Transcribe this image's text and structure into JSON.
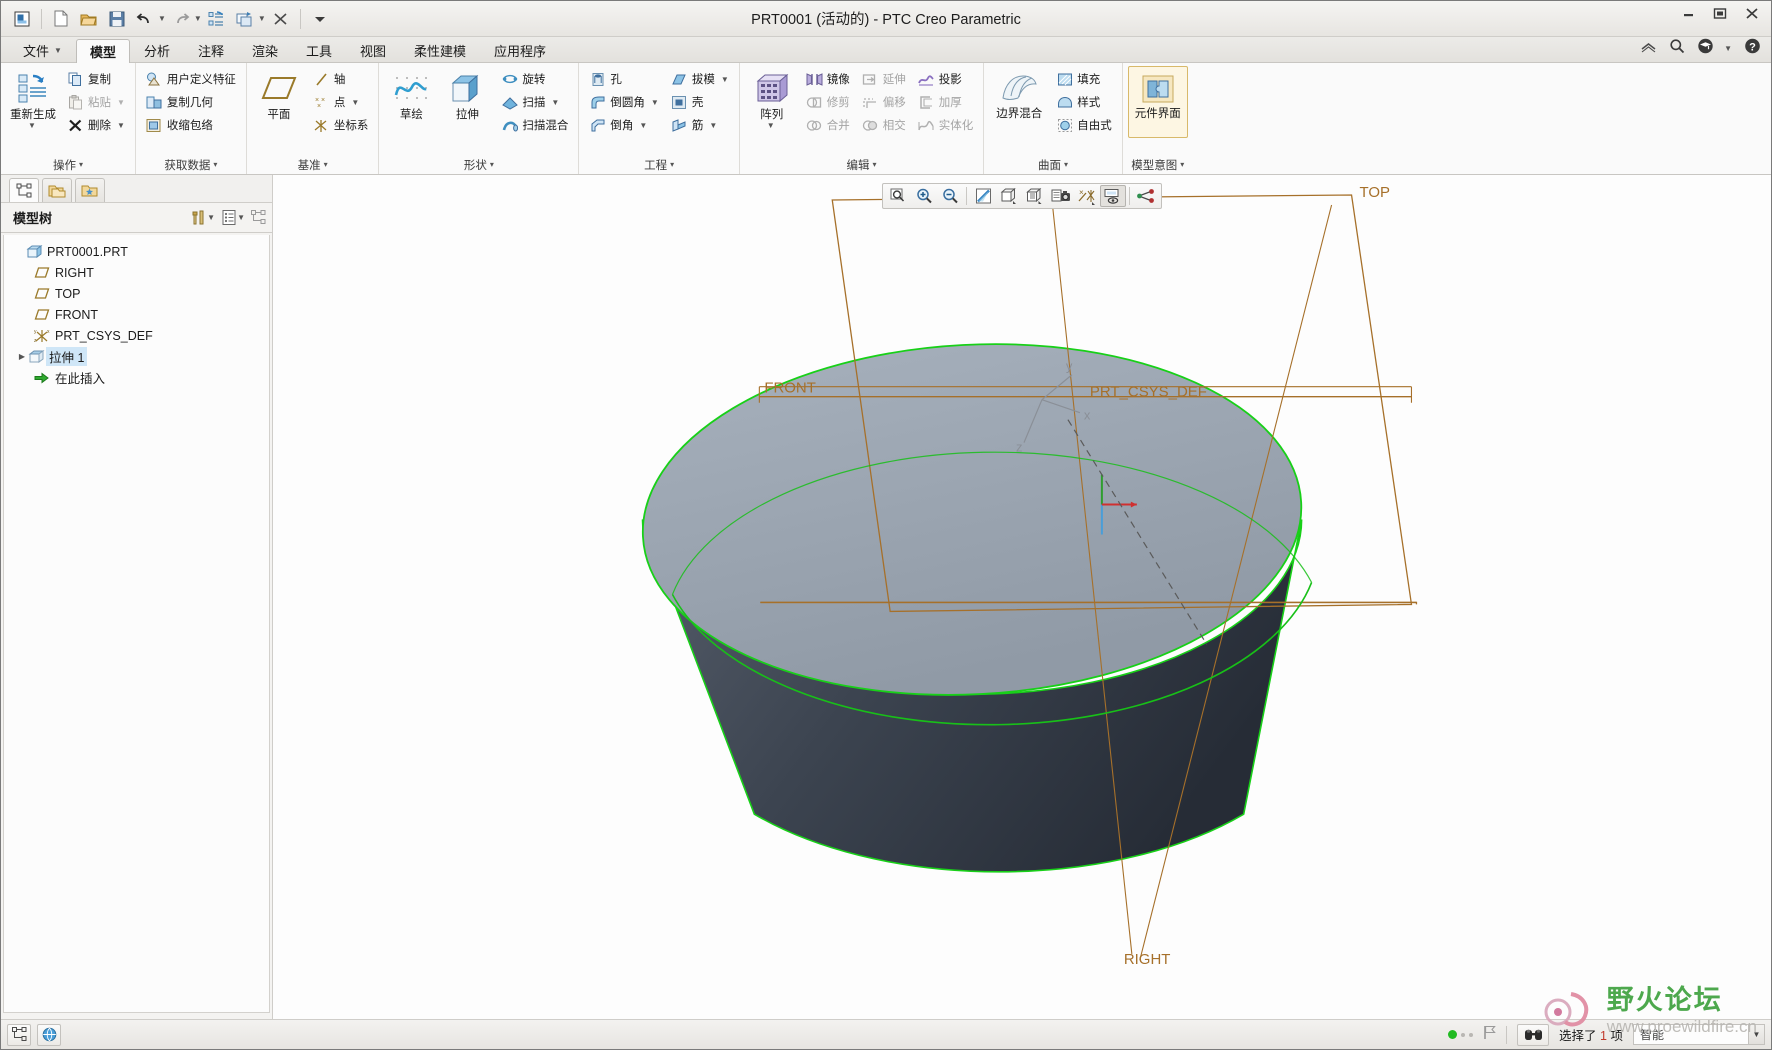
{
  "window": {
    "title": "PRT0001 (活动的) - PTC Creo Parametric",
    "minimize": "—",
    "maximize": "❐",
    "close": "✕"
  },
  "quick_access": [
    {
      "name": "app-icon",
      "icon": "window-icon"
    },
    {
      "name": "new-file",
      "icon": "page-icon"
    },
    {
      "name": "open-file",
      "icon": "folder-open-icon"
    },
    {
      "name": "save-file",
      "icon": "floppy-icon"
    },
    {
      "name": "undo",
      "icon": "undo-arrow-icon"
    },
    {
      "name": "redo",
      "icon": "redo-arrow-icon"
    },
    {
      "name": "regenerate",
      "icon": "regenerate-icon"
    },
    {
      "name": "window-switch",
      "icon": "windows-icon"
    },
    {
      "name": "close-window",
      "icon": "close-x-icon"
    },
    {
      "name": "customize-qat",
      "icon": "chevron-down-icon"
    }
  ],
  "tabs": [
    {
      "label": "文件",
      "dropdown": true,
      "active": false
    },
    {
      "label": "模型",
      "active": true
    },
    {
      "label": "分析",
      "active": false
    },
    {
      "label": "注释",
      "active": false
    },
    {
      "label": "渲染",
      "active": false
    },
    {
      "label": "工具",
      "active": false
    },
    {
      "label": "视图",
      "active": false
    },
    {
      "label": "柔性建模",
      "active": false
    },
    {
      "label": "应用程序",
      "active": false
    }
  ],
  "tab_right_tools": [
    {
      "name": "collapse-ribbon-icon",
      "glyph": "⌃"
    },
    {
      "name": "search-icon",
      "glyph": "search"
    },
    {
      "name": "help-center-icon",
      "glyph": "graduation"
    },
    {
      "name": "help-dropdown-icon",
      "glyph": "▾"
    },
    {
      "name": "help-icon",
      "glyph": "?"
    }
  ],
  "ribbon": {
    "groups": [
      {
        "title": "操作",
        "big": [
          {
            "label": "重新生成",
            "icon": "regenerate-icon",
            "dropdown": true
          }
        ],
        "columns": [
          [
            {
              "label": "复制",
              "icon": "copy-icon",
              "disabled": false
            },
            {
              "label": "粘贴",
              "icon": "paste-icon",
              "disabled": true,
              "dropdown": true
            },
            {
              "label": "删除",
              "icon": "delete-x-icon",
              "disabled": false,
              "dropdown": true
            }
          ]
        ]
      },
      {
        "title": "获取数据",
        "big": [],
        "columns": [
          [
            {
              "label": "用户定义特征",
              "icon": "udf-icon"
            },
            {
              "label": "复制几何",
              "icon": "copy-geometry-icon"
            },
            {
              "label": "收缩包络",
              "icon": "shrinkwrap-icon"
            }
          ]
        ]
      },
      {
        "title": "基准",
        "big": [
          {
            "label": "平面",
            "icon": "datum-plane-icon"
          }
        ],
        "columns": [
          [
            {
              "label": "轴",
              "icon": "datum-axis-icon"
            },
            {
              "label": "点",
              "icon": "datum-point-icon",
              "dropdown": true
            },
            {
              "label": "坐标系",
              "icon": "csys-icon"
            }
          ]
        ]
      },
      {
        "title": "形状",
        "big": [
          {
            "label": "草绘",
            "icon": "sketch-icon"
          },
          {
            "label": "拉伸",
            "icon": "extrude-icon"
          }
        ],
        "columns": [
          [
            {
              "label": "旋转",
              "icon": "revolve-icon"
            },
            {
              "label": "扫描",
              "icon": "sweep-icon",
              "dropdown": true
            },
            {
              "label": "扫描混合",
              "icon": "swept-blend-icon"
            }
          ]
        ]
      },
      {
        "title": "工程",
        "big": [],
        "columns": [
          [
            {
              "label": "孔",
              "icon": "hole-icon"
            },
            {
              "label": "倒圆角",
              "icon": "round-icon",
              "dropdown": true
            },
            {
              "label": "倒角",
              "icon": "chamfer-icon",
              "dropdown": true
            }
          ],
          [
            {
              "label": "拔模",
              "icon": "draft-icon",
              "dropdown": true
            },
            {
              "label": "壳",
              "icon": "shell-icon"
            },
            {
              "label": "筋",
              "icon": "rib-icon",
              "dropdown": true
            }
          ]
        ]
      },
      {
        "title": "编辑",
        "big": [
          {
            "label": "阵列",
            "icon": "pattern-icon",
            "dropdown": true
          }
        ],
        "columns": [
          [
            {
              "label": "镜像",
              "icon": "mirror-icon"
            },
            {
              "label": "修剪",
              "icon": "trim-icon",
              "disabled": true
            },
            {
              "label": "合并",
              "icon": "merge-icon",
              "disabled": true
            }
          ],
          [
            {
              "label": "延伸",
              "icon": "extend-icon",
              "disabled": true
            },
            {
              "label": "偏移",
              "icon": "offset-icon",
              "disabled": true
            },
            {
              "label": "相交",
              "icon": "intersect-icon",
              "disabled": true
            }
          ],
          [
            {
              "label": "投影",
              "icon": "project-icon"
            },
            {
              "label": "加厚",
              "icon": "thicken-icon",
              "disabled": true
            },
            {
              "label": "实体化",
              "icon": "solidify-icon",
              "disabled": true
            }
          ]
        ]
      },
      {
        "title": "曲面",
        "big": [
          {
            "label": "边界混合",
            "icon": "boundary-blend-icon"
          }
        ],
        "columns": [
          [
            {
              "label": "填充",
              "icon": "fill-icon"
            },
            {
              "label": "样式",
              "icon": "style-icon"
            },
            {
              "label": "自由式",
              "icon": "freestyle-icon"
            }
          ]
        ]
      },
      {
        "title": "模型意图",
        "big": [
          {
            "label": "元件界面",
            "icon": "component-interface-icon"
          }
        ],
        "columns": []
      }
    ]
  },
  "left_pane": {
    "nav_tabs": [
      {
        "name": "model-tree-tab",
        "icon": "tree-icon",
        "active": true
      },
      {
        "name": "folder-browser-tab",
        "icon": "folders-icon",
        "active": false
      },
      {
        "name": "favorites-tab",
        "icon": "favorites-folder-icon",
        "active": false
      }
    ],
    "tree_header": {
      "title": "模型树",
      "tools": [
        {
          "name": "tree-filter-icon",
          "glyph": "tools",
          "dropdown": true
        },
        {
          "name": "tree-settings-icon",
          "glyph": "list",
          "dropdown": true
        },
        {
          "name": "tree-show-icon",
          "glyph": "tree"
        }
      ]
    },
    "tree": [
      {
        "label": "PRT0001.PRT",
        "icon": "part-icon",
        "indent": 0,
        "arrow": "",
        "selected": false
      },
      {
        "label": "RIGHT",
        "icon": "datum-plane-icon",
        "indent": 1,
        "arrow": "",
        "selected": false
      },
      {
        "label": "TOP",
        "icon": "datum-plane-icon",
        "indent": 1,
        "arrow": "",
        "selected": false
      },
      {
        "label": "FRONT",
        "icon": "datum-plane-icon",
        "indent": 1,
        "arrow": "",
        "selected": false
      },
      {
        "label": "PRT_CSYS_DEF",
        "icon": "csys-icon",
        "indent": 1,
        "arrow": "",
        "selected": false
      },
      {
        "label": "拉伸 1",
        "icon": "extrude-feature-icon",
        "indent": 1,
        "arrow": "▶",
        "selected": true
      },
      {
        "label": "在此插入",
        "icon": "insert-here-icon",
        "indent": 1,
        "arrow": "",
        "selected": false
      }
    ]
  },
  "graphics_toolbar": [
    {
      "name": "zoom-to-fit-icon",
      "glyph": "fit"
    },
    {
      "name": "zoom-in-icon",
      "glyph": "zoom-in"
    },
    {
      "name": "zoom-out-icon",
      "glyph": "zoom-out"
    },
    {
      "name": "repaint-icon",
      "glyph": "repaint"
    },
    {
      "name": "display-style-icon",
      "glyph": "shaded",
      "dropdown": true
    },
    {
      "name": "saved-views-icon",
      "glyph": "views",
      "dropdown": true
    },
    {
      "name": "render-icon",
      "glyph": "camera"
    },
    {
      "name": "datum-display-icon",
      "glyph": "datums",
      "dropdown": true
    },
    {
      "name": "annotation-display-icon",
      "glyph": "annotation",
      "toggled": true
    },
    {
      "name": "spin-center-icon",
      "glyph": "spin-center"
    }
  ],
  "viewport": {
    "labels": {
      "top_plane": "TOP",
      "front_plane": "FRONT",
      "right_plane": "RIGHT",
      "csys": "PRT_CSYS_DEF",
      "axis_x": "x",
      "axis_y": "y",
      "axis_z": "z"
    },
    "colors": {
      "top_face": "#9aa4b0",
      "side_face": "#3d4450",
      "datum_plane": "#a6702a",
      "edge_highlight": "#18d018",
      "csys_text": "#8a8f97"
    }
  },
  "status_bar": {
    "left_buttons": [
      {
        "name": "model-tree-toggle",
        "icon": "tree-icon"
      },
      {
        "name": "browser-toggle",
        "icon": "globe-icon"
      }
    ],
    "message": "选择了",
    "count": "1",
    "message_suffix": "项",
    "select_filter": "智能",
    "filter_caret": "▾",
    "indicators": [
      {
        "name": "regen-status-indicator",
        "icon": "green-dot"
      },
      {
        "name": "flag-indicator",
        "icon": "flag-icon"
      },
      {
        "name": "search-tool-icon",
        "icon": "binoculars-icon"
      }
    ]
  },
  "watermark": {
    "text": "野火论坛",
    "url": "www.proewildfire.cn"
  }
}
